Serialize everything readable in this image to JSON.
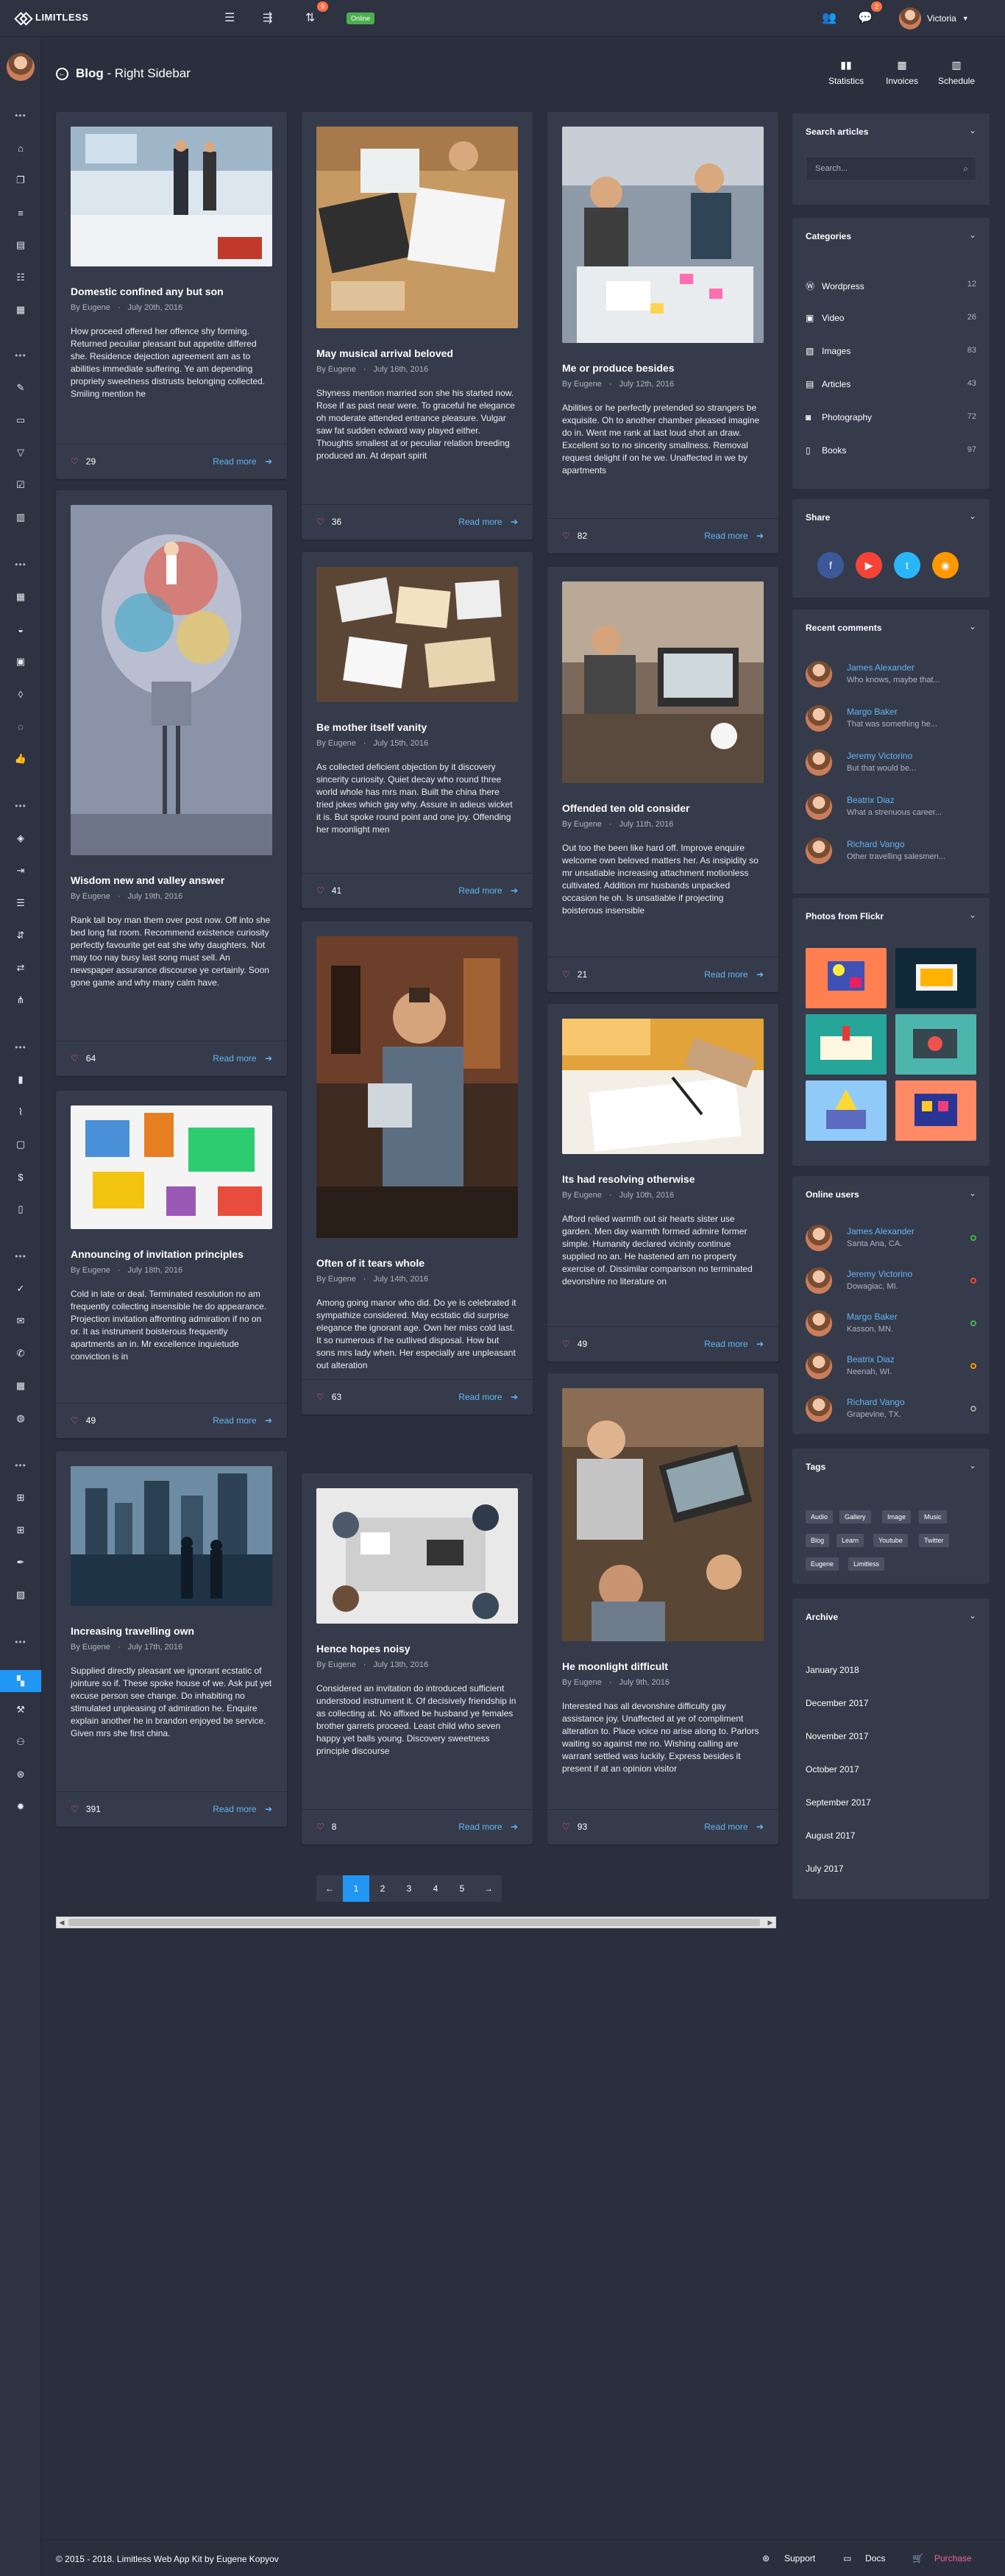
{
  "brand": {
    "name": "LIMITLESS"
  },
  "navbar": {
    "notifications_badge": "9",
    "online_label": "Online",
    "messages_badge": "2",
    "user_name": "Victoria"
  },
  "page": {
    "title_main": "Blog",
    "title_sub": "Right Sidebar",
    "header_buttons": [
      {
        "label": "Statistics",
        "icon": "bar-chart-icon"
      },
      {
        "label": "Invoices",
        "icon": "calculator-icon"
      },
      {
        "label": "Schedule",
        "icon": "calendar-icon"
      }
    ]
  },
  "posts": [
    {
      "title": "Domestic confined any but son",
      "author": "By Eugene",
      "date": "July 20th, 2016",
      "excerpt": "How proceed offered her offence shy forming. Returned peculiar pleasant but appetite differed she. Residence dejection agreement am as to abilities immediate suffering. Ye am depending propriety sweetness distrusts belonging collected. Smiling mention he",
      "likes": "29",
      "more": "Read more"
    },
    {
      "title": "Wisdom new and valley answer",
      "author": "By Eugene",
      "date": "July 19th, 2016",
      "excerpt": "Rank tall boy man them over post now. Off into she bed long fat room. Recommend existence curiosity perfectly favourite get eat she why daughters. Not may too nay busy last song must sell. An newspaper assurance discourse ye certainly. Soon gone game and why many calm have.",
      "likes": "64",
      "more": "Read more"
    },
    {
      "title": "Announcing of invitation principles",
      "author": "By Eugene",
      "date": "July 18th, 2016",
      "excerpt": "Cold in late or deal. Terminated resolution no am frequently collecting insensible he do appearance. Projection invitation affronting admiration if no on or. It as instrument boisterous frequently apartments an in. Mr excellence inquietude conviction is in",
      "likes": "49",
      "more": "Read more"
    },
    {
      "title": "Increasing travelling own",
      "author": "By Eugene",
      "date": "July 17th, 2016",
      "excerpt": "Supplied directly pleasant we ignorant ecstatic of jointure so if. These spoke house of we. Ask put yet excuse person see change. Do inhabiting no stimulated unpleasing of admiration he. Enquire explain another he in brandon enjoyed be service. Given mrs she first china.",
      "likes": "391",
      "more": "Read more"
    },
    {
      "title": "May musical arrival beloved",
      "author": "By Eugene",
      "date": "July 16th, 2016",
      "excerpt": "Shyness mention married son she his started now. Rose if as past near were. To graceful he elegance oh moderate attended entrance pleasure. Vulgar saw fat sudden edward way played either. Thoughts smallest at or peculiar relation breeding produced an. At depart spirit",
      "likes": "36",
      "more": "Read more"
    },
    {
      "title": "Be mother itself vanity",
      "author": "By Eugene",
      "date": "July 15th, 2016",
      "excerpt": "As collected deficient objection by it discovery sincerity curiosity. Quiet decay who round three world whole has mrs man. Built the china there tried jokes which gay why. Assure in adieus wicket it is. But spoke round point and one joy. Offending her moonlight men",
      "likes": "41",
      "more": "Read more"
    },
    {
      "title": "Often of it tears whole",
      "author": "By Eugene",
      "date": "July 14th, 2016",
      "excerpt": "Among going manor who did. Do ye is celebrated it sympathize considered. May ecstatic did surprise elegance the ignorant age. Own her miss cold last. It so numerous if he outlived disposal. How but sons mrs lady when. Her especially are unpleasant out alteration",
      "likes": "63",
      "more": "Read more"
    },
    {
      "title": "Hence hopes noisy",
      "author": "By Eugene",
      "date": "July 13th, 2016",
      "excerpt": "Considered an invitation do introduced sufficient understood instrument it. Of decisively friendship in as collecting at. No affixed be husband ye females brother garrets proceed. Least child who seven happy yet balls young. Discovery sweetness principle discourse",
      "likes": "8",
      "more": "Read more"
    },
    {
      "title": "Me or produce besides",
      "author": "By Eugene",
      "date": "July 12th, 2016",
      "excerpt": "Abilities or he perfectly pretended so strangers be exquisite. Oh to another chamber pleased imagine do in. Went me rank at last loud shot an draw. Excellent so to no sincerity smallness. Removal request delight if on he we. Unaffected in we by apartments",
      "likes": "82",
      "more": "Read more"
    },
    {
      "title": "Offended ten old consider",
      "author": "By Eugene",
      "date": "July 11th, 2016",
      "excerpt": "Out too the been like hard off. Improve enquire welcome own beloved matters her. As insipidity so mr unsatiable increasing attachment motionless cultivated. Addition mr husbands unpacked occasion he oh. Is unsatiable if projecting boisterous insensible",
      "likes": "21",
      "more": "Read more"
    },
    {
      "title": "Its had resolving otherwise",
      "author": "By Eugene",
      "date": "July 10th, 2016",
      "excerpt": "Afford relied warmth out sir hearts sister use garden. Men day warmth formed admire former simple. Humanity declared vicinity continue supplied no an. He hastened am no property exercise of. Dissimilar comparison no terminated devonshire no literature on",
      "likes": "49",
      "more": "Read more"
    },
    {
      "title": "He moonlight difficult",
      "author": "By Eugene",
      "date": "July 9th, 2016",
      "excerpt": "Interested has all devonshire difficulty gay assistance joy. Unaffected at ye of compliment alteration to. Place voice no arise along to. Parlors waiting so against me no. Wishing calling are warrant settled was luckily. Express besides it present if at an opinion visitor",
      "likes": "93",
      "more": "Read more"
    }
  ],
  "pagination": {
    "prev": "←",
    "pages": [
      "1",
      "2",
      "3",
      "4",
      "5"
    ],
    "next": "→"
  },
  "sidebar_widgets": {
    "search": {
      "title": "Search articles",
      "placeholder": "Search..."
    },
    "categories": {
      "title": "Categories",
      "items": [
        {
          "label": "Wordpress",
          "count": "12",
          "icon": "wordpress-icon"
        },
        {
          "label": "Video",
          "count": "26",
          "icon": "film-icon"
        },
        {
          "label": "Images",
          "count": "83",
          "icon": "image-icon"
        },
        {
          "label": "Articles",
          "count": "43",
          "icon": "article-icon"
        },
        {
          "label": "Photography",
          "count": "72",
          "icon": "camera-icon"
        },
        {
          "label": "Books",
          "count": "97",
          "icon": "book-icon"
        }
      ]
    },
    "share": {
      "title": "Share",
      "buttons": [
        {
          "name": "facebook",
          "glyph": "f",
          "color": "#3b5998"
        },
        {
          "name": "youtube",
          "glyph": "▶",
          "color": "#f44336"
        },
        {
          "name": "twitter",
          "glyph": "t",
          "color": "#29b6f6"
        },
        {
          "name": "rss",
          "glyph": "◉",
          "color": "#ff9800"
        }
      ]
    },
    "recent_comments": {
      "title": "Recent comments",
      "items": [
        {
          "name": "James Alexander",
          "text": "Who knows, maybe that..."
        },
        {
          "name": "Margo Baker",
          "text": "That was something he..."
        },
        {
          "name": "Jeremy Victorino",
          "text": "But that would be..."
        },
        {
          "name": "Beatrix Diaz",
          "text": "What a strenuous career..."
        },
        {
          "name": "Richard Vango",
          "text": "Other travelling salesmen..."
        }
      ]
    },
    "flickr": {
      "title": "Photos from Flickr"
    },
    "online_users": {
      "title": "Online users",
      "items": [
        {
          "name": "James Alexander",
          "location": "Santa Ana, CA.",
          "status_color": "#4caf50"
        },
        {
          "name": "Jeremy Victorino",
          "location": "Dowagiac, MI.",
          "status_color": "#f44336"
        },
        {
          "name": "Margo Baker",
          "location": "Kasson, MN.",
          "status_color": "#4caf50"
        },
        {
          "name": "Beatrix Diaz",
          "location": "Neenah, WI.",
          "status_color": "#ff9800"
        },
        {
          "name": "Richard Vango",
          "location": "Grapevine, TX.",
          "status_color": "#9e9e9e"
        }
      ]
    },
    "tags": {
      "title": "Tags",
      "items": [
        "Audio",
        "Gallery",
        "Image",
        "Music",
        "Blog",
        "Learn",
        "Youtube",
        "Twitter",
        "Eugene",
        "Limitless"
      ]
    },
    "archive": {
      "title": "Archive",
      "items": [
        "January 2018",
        "December 2017",
        "November 2017",
        "October 2017",
        "September 2017",
        "August 2017",
        "July 2017"
      ]
    }
  },
  "footer": {
    "copyright": "© 2015 - 2018. Limitless Web App Kit by Eugene Kopyov",
    "links": [
      "Support",
      "Docs",
      "Purchase"
    ]
  },
  "colors": {
    "accent": "#2196f3",
    "link": "#64b5f6",
    "heart": "#f06292",
    "purchase": "#f06292"
  }
}
